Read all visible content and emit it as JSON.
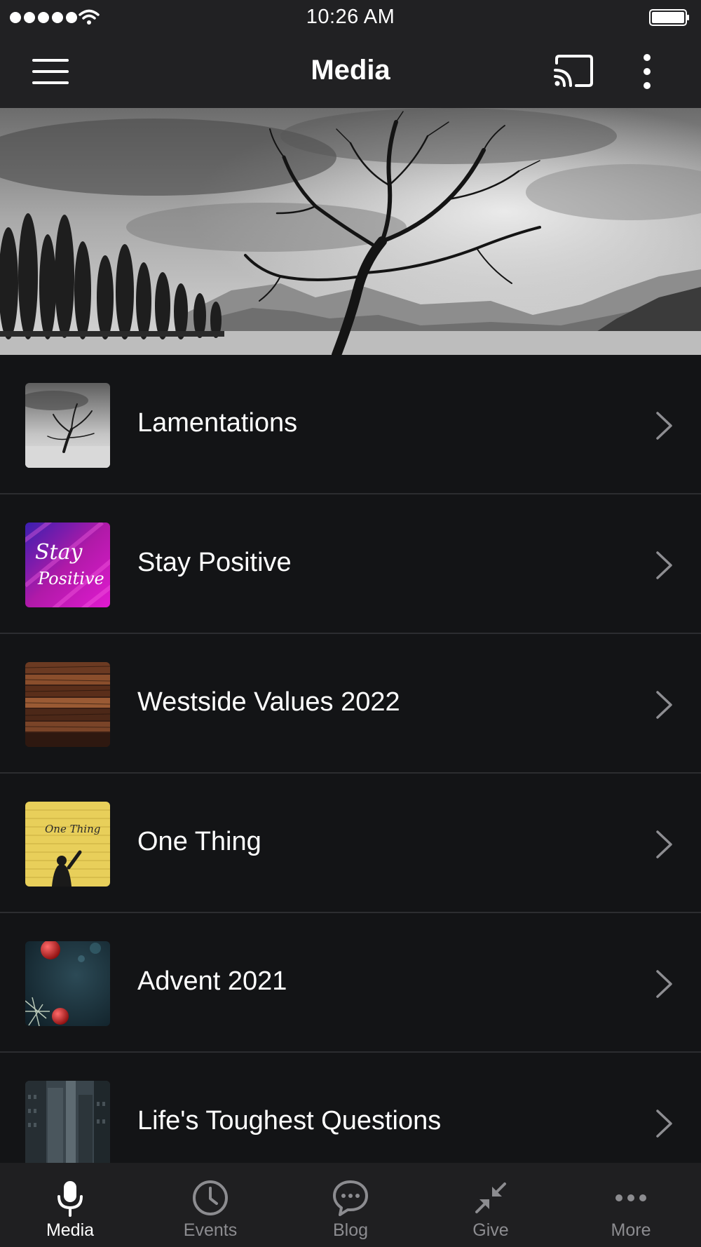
{
  "status_bar": {
    "time": "10:26 AM",
    "signal_icon": "signal-dots-icon",
    "wifi_icon": "wifi-icon",
    "battery_icon": "battery-icon"
  },
  "app_bar": {
    "title": "Media",
    "menu_icon": "hamburger-menu-icon",
    "cast_icon": "cast-icon",
    "more_icon": "vertical-ellipsis-icon"
  },
  "hero": {
    "image": "black-and-white tree landscape"
  },
  "series": [
    {
      "title": "Lamentations",
      "thumbnail": "lone tree in lake"
    },
    {
      "title": "Stay Positive",
      "thumbnail": "purple gradient with script text"
    },
    {
      "title": "Westside Values 2022",
      "thumbnail": "wooden planks"
    },
    {
      "title": "One Thing",
      "thumbnail": "person writing on yellow brick wall"
    },
    {
      "title": "Advent 2021",
      "thumbnail": "christmas ornaments"
    },
    {
      "title": "Life's Toughest Questions",
      "thumbnail": "city buildings"
    }
  ],
  "thumb_text": {
    "stay_positive_line1": "Stay",
    "stay_positive_line2": "Positive",
    "one_thing": "One Thing"
  },
  "tabs": [
    {
      "label": "Media",
      "icon": "microphone-icon",
      "active": true
    },
    {
      "label": "Events",
      "icon": "clock-icon",
      "active": false
    },
    {
      "label": "Blog",
      "icon": "chat-bubble-icon",
      "active": false
    },
    {
      "label": "Give",
      "icon": "compress-arrows-icon",
      "active": false
    },
    {
      "label": "More",
      "icon": "horizontal-ellipsis-icon",
      "active": false
    }
  ],
  "colors": {
    "background": "#131416",
    "bar": "#212123",
    "divider": "#2c2d30",
    "tab_inactive": "#8c8c90",
    "tab_active": "#ffffff"
  }
}
